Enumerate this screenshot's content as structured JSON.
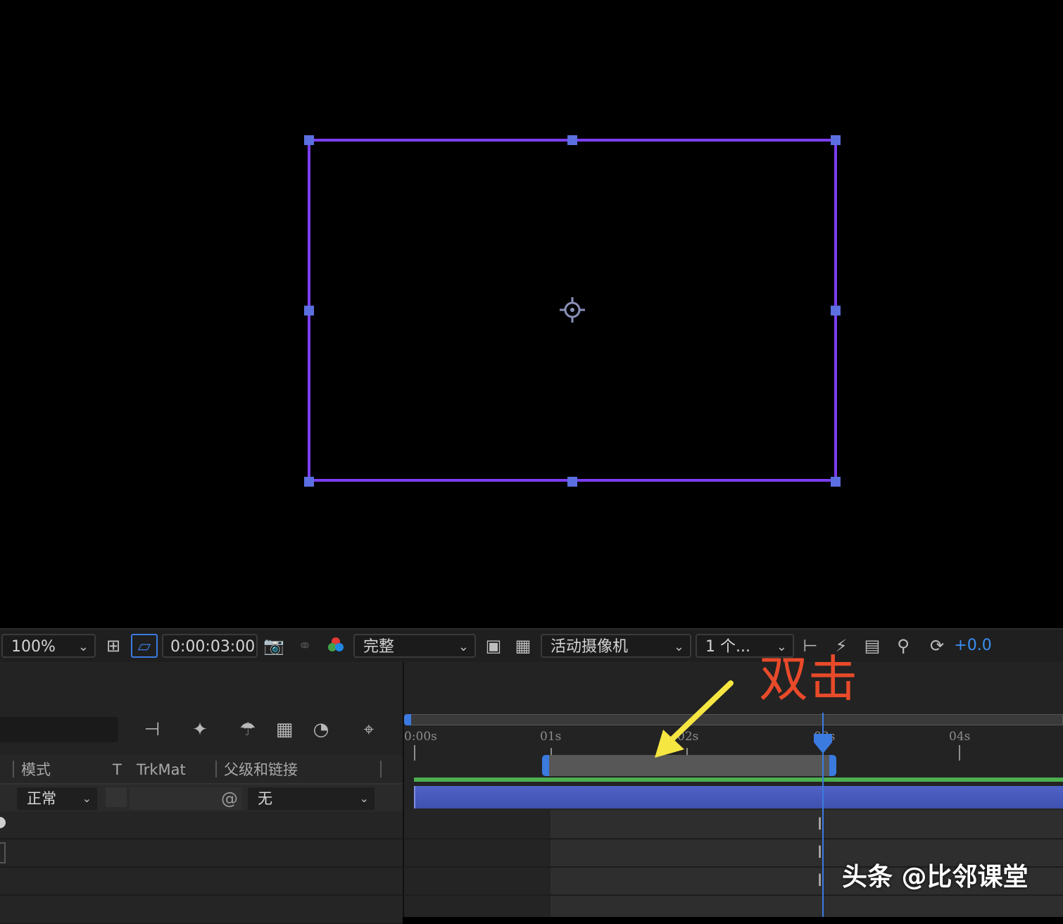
{
  "toolbar": {
    "zoom": "100%",
    "timecode": "0:00:03:00",
    "resolution": "完整",
    "camera": "活动摄像机",
    "views": "1 个...",
    "exposure": "+0.0"
  },
  "timeline": {
    "columns": {
      "mode": "模式",
      "t": "T",
      "trkmat": "TrkMat",
      "parent": "父级和链接"
    },
    "layer": {
      "mode_value": "正常",
      "parent_value": "无"
    },
    "ruler_labels": [
      "0:00s",
      "01s",
      "02s",
      "03s",
      "04s"
    ]
  },
  "annotation": {
    "text": "双击",
    "color": "#e84a2a"
  },
  "watermark": "头条 @比邻课堂",
  "colors": {
    "frame": "#7b3ef2",
    "handle": "#5b6fe0",
    "layer_bar": "#4658b8",
    "playhead": "#3b7be0",
    "arrow": "#f5e642"
  }
}
